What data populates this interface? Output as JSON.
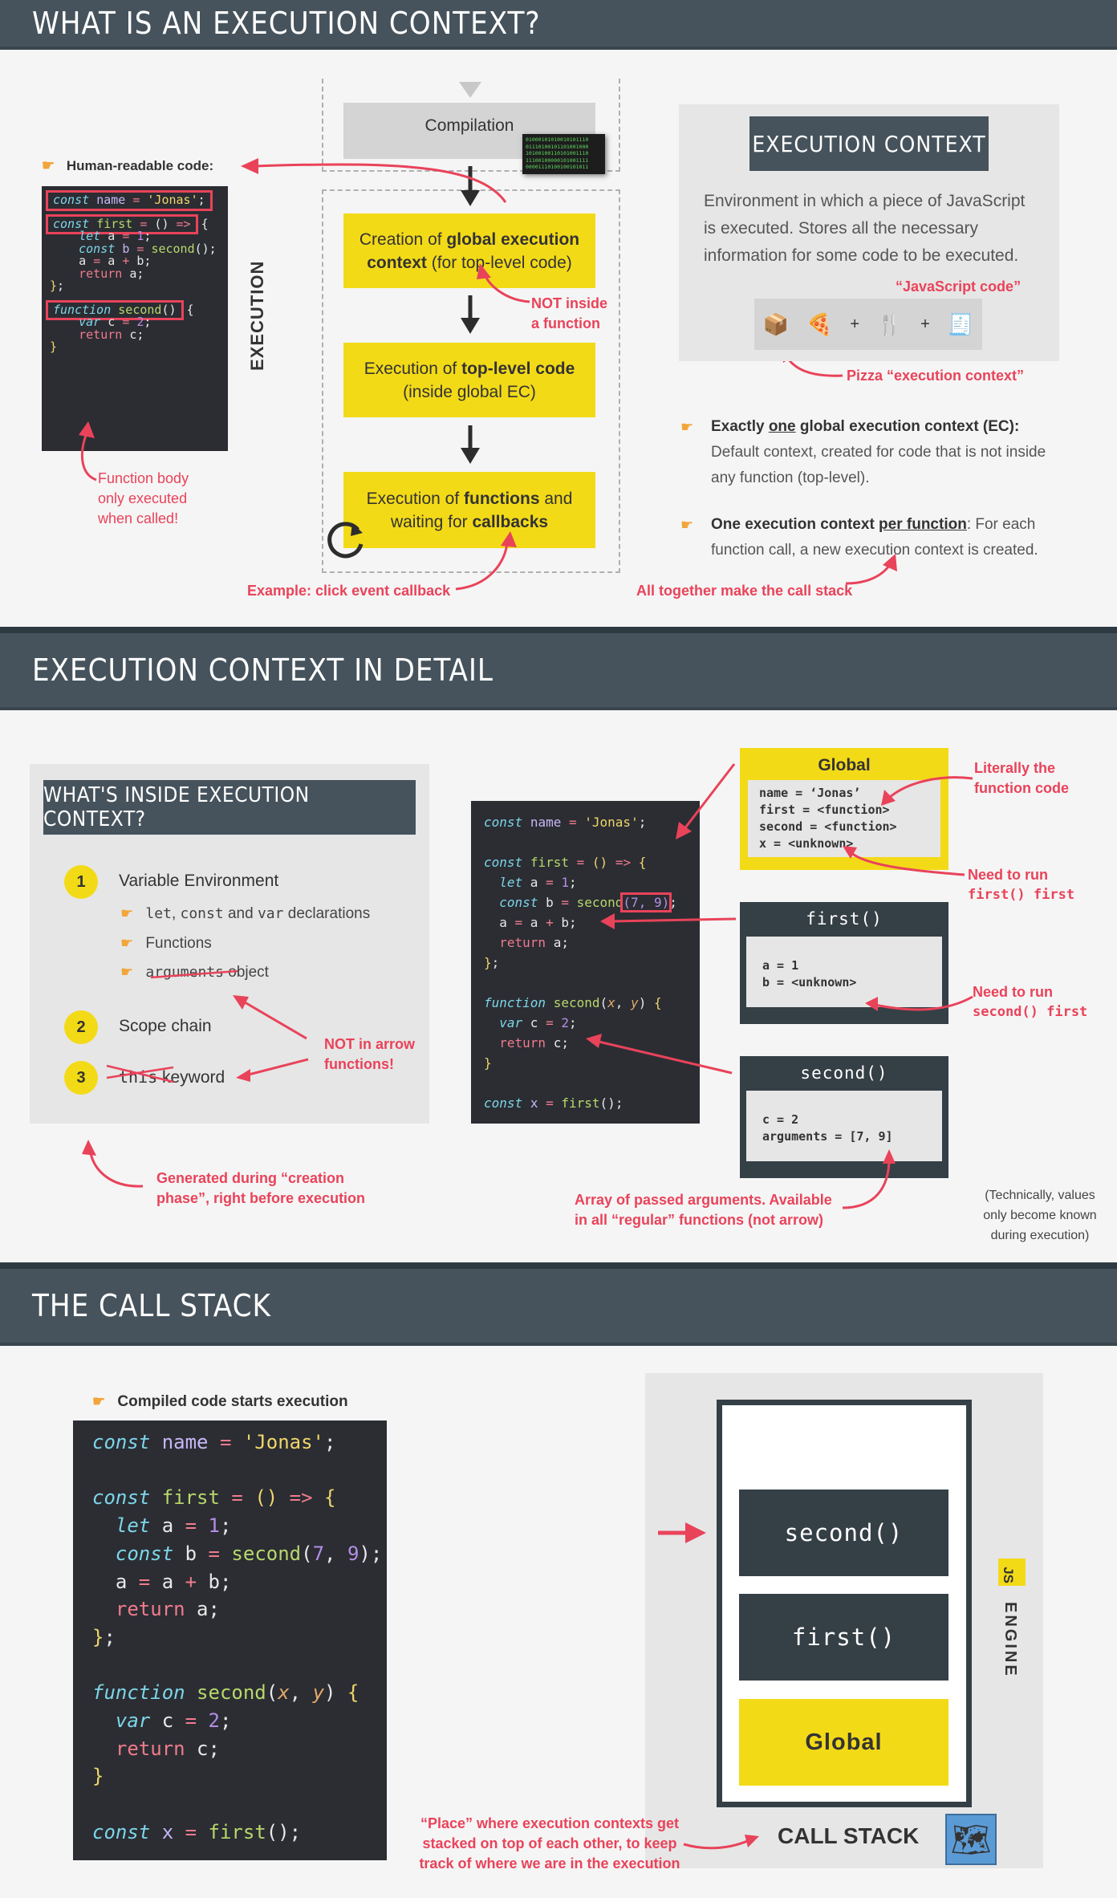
{
  "sections": {
    "s1_title": "WHAT IS AN EXECUTION CONTEXT?",
    "s2_title": "EXECUTION CONTEXT IN DETAIL",
    "s3_title": "THE CALL STACK"
  },
  "s1": {
    "human_readable": "Human-readable code:",
    "compilation": "Compilation",
    "binary_lines": [
      "01000101010010101110",
      "01110100101101001000",
      "10100100110101001110",
      "11100100000101001111",
      "00001110100100101011"
    ],
    "execution_label": "EXECUTION",
    "step1_pre": "Creation of ",
    "step1_bold": "global execution context",
    "step1_post": " (for top-level code)",
    "step2_pre": "Execution of ",
    "step2_bold": "top-level code",
    "step2_post": "(inside global EC)",
    "step3_pre": "Execution of ",
    "step3_bold1": "functions",
    "step3_mid": " and waiting for ",
    "step3_bold2": "callbacks",
    "not_inside": "NOT inside a function",
    "fn_body": "Function body only executed when called!",
    "click_callback": "Example: click event callback",
    "ec_box_title": "EXECUTION CONTEXT",
    "ec_desc": "Environment in which a piece of JavaScript is executed. Stores all the necessary information for some code to be executed.",
    "js_code_label": "“JavaScript code”",
    "pizza_label": "Pizza “execution context”",
    "bullet1_pre": "Exactly ",
    "bullet1_u": "one",
    "bullet1_bold": " global execution context (EC):",
    "bullet1_text": "Default context, created for code that is not inside any function (top-level).",
    "bullet2_bold": "One execution context ",
    "bullet2_u": "per function",
    "bullet2_text": ": For each function call, a new execution context is created.",
    "call_stack_note": "All together make the call stack"
  },
  "s2": {
    "whats_inside": "WHAT'S INSIDE EXECUTION CONTEXT?",
    "item1": "Variable Environment",
    "item1_sub1_code1": "let",
    "item1_sub1_sep1": ", ",
    "item1_sub1_code2": "const",
    "item1_sub1_sep2": " and ",
    "item1_sub1_code3": "var",
    "item1_sub1_text": " declarations",
    "item1_sub2": "Functions",
    "item1_sub3_code": "arguments",
    "item1_sub3_text": " object",
    "item2": "Scope chain",
    "item3_code": "this",
    "item3_text": " keyword",
    "num1": "1",
    "num2": "2",
    "num3": "3",
    "not_arrow": "NOT in arrow functions!",
    "generated": "Generated during “creation phase”, right before execution",
    "global_hdr": "Global",
    "global_body": "name = ‘Jonas’\nfirst = <function>\nsecond = <function>\nx = <unknown>",
    "first_hdr": "first()",
    "first_body": "a = 1\nb = <unknown>",
    "second_hdr": "second()",
    "second_body": "c = 2\narguments = [7, 9]",
    "literally": "Literally the function code",
    "need_first_pre": "Need to run",
    "need_first_code": "first() first",
    "need_second_pre": "Need to run",
    "need_second_code": "second() first",
    "array_args": "Array of passed arguments. Available in all “regular” functions (not arrow)",
    "technically": "(Technically, values only become known during execution)"
  },
  "s3": {
    "compiled_starts": "Compiled code starts execution",
    "stack_items": [
      "second()",
      "first()",
      "Global"
    ],
    "call_stack": "CALL STACK",
    "js_badge": "JS",
    "engine": "ENGINE",
    "place_note": "“Place” where execution contexts get stacked on top of each other, to keep track of where we are in the execution"
  },
  "colors": {
    "banner": "#46535c",
    "accent_yellow": "#f3da17",
    "accent_red": "#e9435a",
    "dark_box": "#353f46",
    "code_bg": "#2b2d33"
  }
}
